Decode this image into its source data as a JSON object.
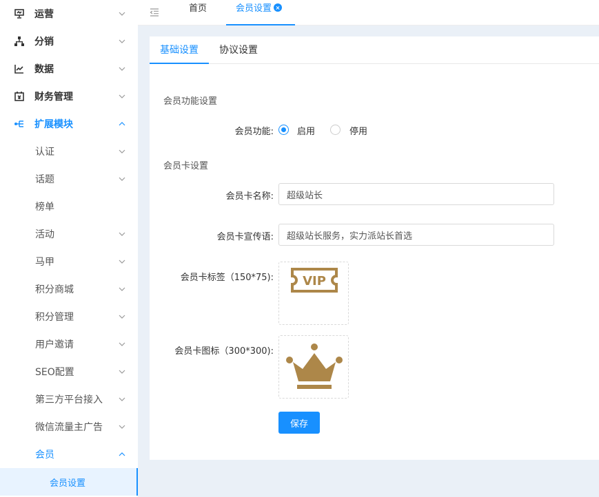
{
  "sidebar": {
    "top_items": [
      {
        "label": "运营",
        "icon": "presentation-icon"
      },
      {
        "label": "分销",
        "icon": "hierarchy-icon"
      },
      {
        "label": "数据",
        "icon": "line-chart-icon"
      },
      {
        "label": "财务管理",
        "icon": "finance-icon"
      },
      {
        "label": "扩展模块",
        "icon": "extension-icon"
      }
    ],
    "sub_items": [
      {
        "label": "认证"
      },
      {
        "label": "话题"
      },
      {
        "label": "榜单"
      },
      {
        "label": "活动"
      },
      {
        "label": "马甲"
      },
      {
        "label": "积分商城"
      },
      {
        "label": "积分管理"
      },
      {
        "label": "用户邀请"
      },
      {
        "label": "SEO配置"
      },
      {
        "label": "第三方平台接入"
      },
      {
        "label": "微信流量主广告"
      },
      {
        "label": "会员"
      }
    ],
    "leaf_item": {
      "label": "会员设置"
    }
  },
  "topbar": {
    "home_tab": "首页",
    "current_tab": "会员设置"
  },
  "panel": {
    "tabs": [
      {
        "label": "基础设置"
      },
      {
        "label": "协议设置"
      }
    ],
    "section_function": "会员功能设置",
    "function_label": "会员功能:",
    "radio_enable": "启用",
    "radio_disable": "停用",
    "section_card": "会员卡设置",
    "card_name_label": "会员卡名称:",
    "card_name_value": "超级站长",
    "card_slogan_label": "会员卡宣传语:",
    "card_slogan_value": "超级站长服务，实力派站长首选",
    "card_tag_label": "会员卡标签（150*75):",
    "card_tag_text": "VIP",
    "card_icon_label": "会员卡图标（300*300):",
    "save_label": "保存"
  },
  "colors": {
    "accent": "#1890ff",
    "gold": "#ad8749"
  }
}
